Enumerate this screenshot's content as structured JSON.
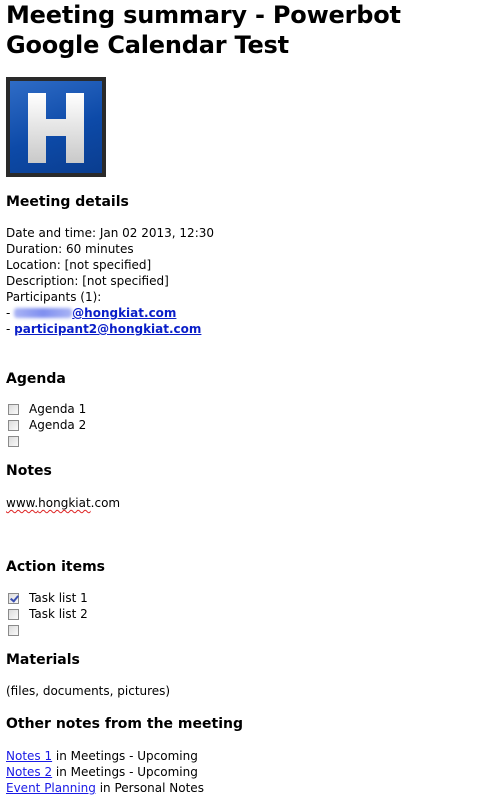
{
  "title": "Meeting summary - Powerbot Google Calendar Test",
  "logo": {
    "icon": "h-letter-logo",
    "letter": "H",
    "colors": {
      "background": "#0d4aa8",
      "frame": "#2a2a2a",
      "letter": "#f2f2f2"
    }
  },
  "meeting_details": {
    "heading": "Meeting details",
    "date_time": "Date and time: Jan 02 2013, 12:30",
    "duration": "Duration: 60 minutes",
    "location": "Location: [not specified]",
    "description": "Description: [not specified]",
    "participants_label": "Participants (1):",
    "participants": [
      {
        "prefix": "- ",
        "email": "@hongkiat.com",
        "redacted": true
      },
      {
        "prefix": "- ",
        "email": "participant2@hongkiat.com",
        "redacted": false
      }
    ]
  },
  "agenda": {
    "heading": "Agenda",
    "items": [
      {
        "label": "Agenda 1",
        "checked": false
      },
      {
        "label": "Agenda 2",
        "checked": false
      },
      {
        "label": "",
        "checked": false
      }
    ]
  },
  "notes": {
    "heading": "Notes",
    "text_prefix": "www.",
    "text_misspelled": "hongkiat",
    "text_suffix": ".com"
  },
  "action_items": {
    "heading": "Action items",
    "items": [
      {
        "label": "Task list 1",
        "checked": true
      },
      {
        "label": "Task list 2",
        "checked": false
      },
      {
        "label": "",
        "checked": false
      }
    ]
  },
  "materials": {
    "heading": "Materials",
    "text": "(files, documents, pictures)"
  },
  "other_notes": {
    "heading": "Other notes from the meeting",
    "items": [
      {
        "link": "Notes 1",
        "suffix": " in Meetings - Upcoming"
      },
      {
        "link": "Notes 2",
        "suffix": " in Meetings - Upcoming"
      },
      {
        "link": "Event Planning",
        "suffix": " in Personal Notes"
      }
    ]
  }
}
